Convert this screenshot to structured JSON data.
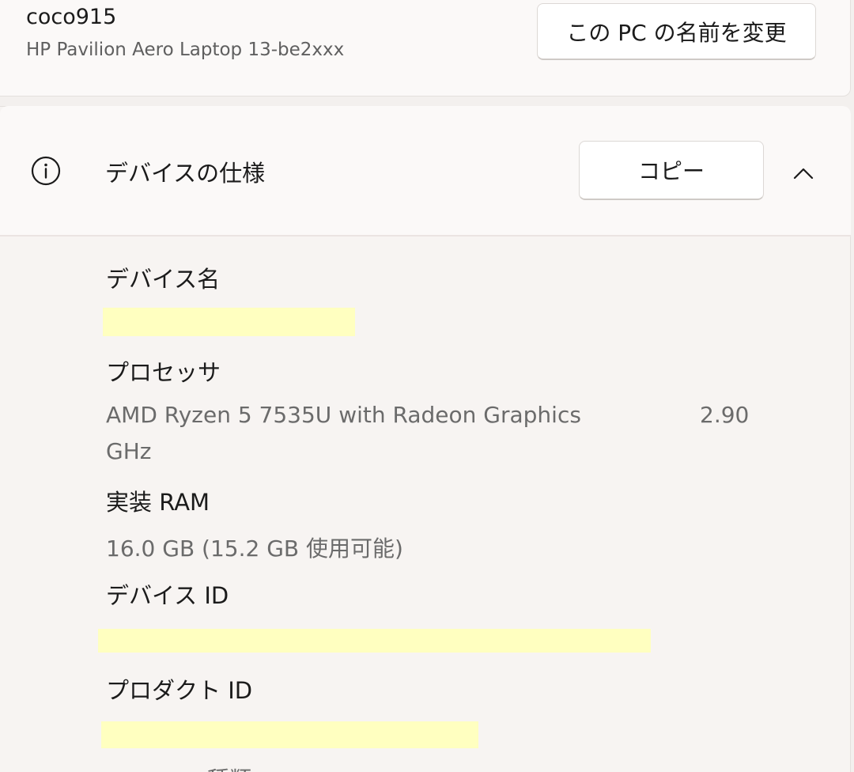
{
  "pc": {
    "name": "coco915",
    "model": "HP Pavilion Aero Laptop 13-be2xxx",
    "rename_label": "この PC の名前を変更"
  },
  "specs": {
    "title": "デバイスの仕様",
    "copy_label": "コピー",
    "info_icon": "info-circle-icon",
    "chevron_icon": "chevron-up-icon",
    "device_name": {
      "label": "デバイス名",
      "value": ""
    },
    "processor": {
      "label": "プロセッサ",
      "value_line1": "AMD Ryzen 5 7535U with Radeon Graphics",
      "speed": "2.90",
      "value_line2": "GHz"
    },
    "ram": {
      "label": "実装 RAM",
      "value": "16.0 GB (15.2 GB 使用可能)"
    },
    "device_id": {
      "label": "デバイス ID",
      "value": ""
    },
    "product_id": {
      "label": "プロダクト ID",
      "value": ""
    },
    "next_label_partial": "種類"
  },
  "colors": {
    "background": "#f3f0ee",
    "card": "#fbf9f8",
    "redaction_highlight": "#ffffc0",
    "secondary_text": "#6b6b6b"
  }
}
